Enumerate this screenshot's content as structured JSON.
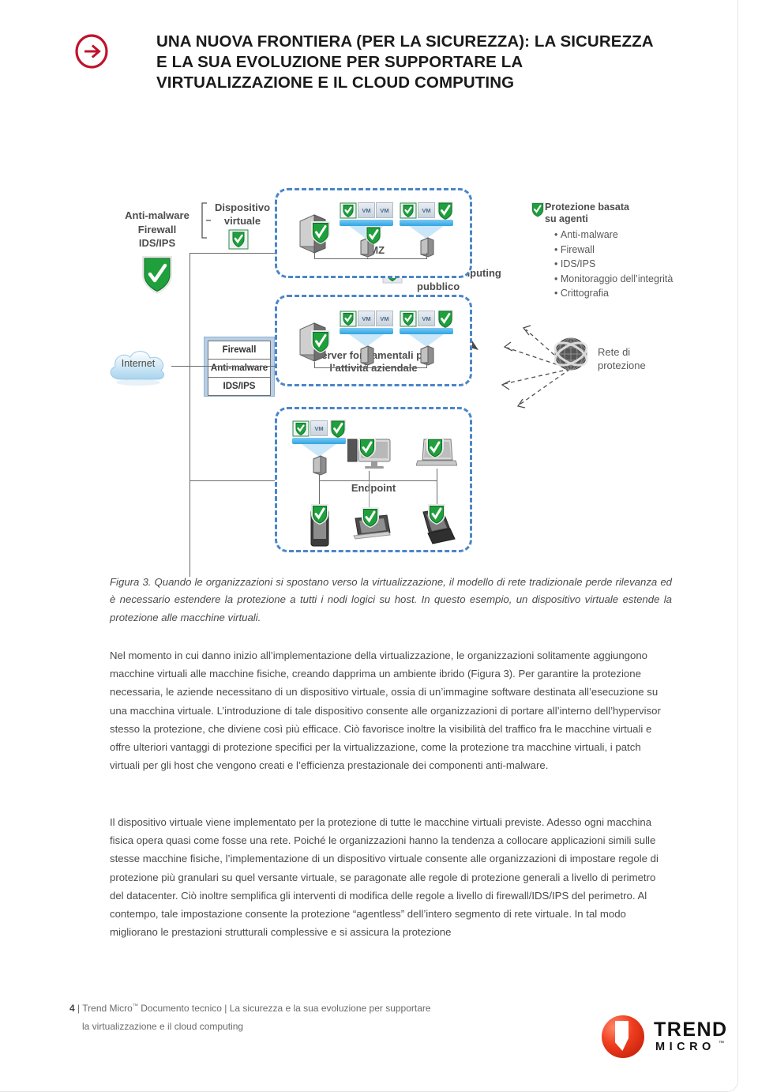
{
  "header": {
    "arrow_icon": "circle-arrow-right-icon",
    "title": "UNA NUOVA FRONTIERA (PER LA SICUREZZA): LA SICUREZZA E LA SUA EVOLUZIONE PER SUPPORTARE LA VIRTUALIZZAZIONE E IL CLOUD COMPUTING"
  },
  "figure": {
    "cloud_public_label": "Cloud computing\npubblico",
    "left_label": "Anti-malware\nFirewall\nIDS/IPS",
    "virtual_appliance_label": "Dispositivo\nvirtuale",
    "internet_label": "Internet",
    "firewall_box": [
      "Firewall",
      "Anti-malware",
      "IDS/IPS"
    ],
    "zones": [
      {
        "caption": "DMZ"
      },
      {
        "caption": "Server fondamentali per\nl’attività aziendale"
      },
      {
        "caption": "Endpoint"
      }
    ],
    "vm_chip_label": "VM",
    "agent_protection": {
      "title": "Protezione basata\nsu agenti",
      "items": [
        "Anti-malware",
        "Firewall",
        "IDS/IPS",
        "Monitoraggio dell’integrità",
        "Crittografia"
      ]
    },
    "protection_network_label": "Rete di\nprotezione",
    "colors": {
      "zone_border": "#4a86c8",
      "shield_green": "#1fa03c",
      "vm_bar": "#2fa6e4",
      "firewall_box_fill": "#b9cfe6"
    }
  },
  "caption": "Figura 3. Quando le organizzazioni si spostano verso la virtualizzazione, il modello di rete tradizionale perde rilevanza ed è necessario estendere la protezione a tutti i nodi logici su host. In questo esempio, un dispositivo virtuale estende la protezione alle macchine virtuali.",
  "body": {
    "p1": "Nel momento in cui danno inizio all’implementazione della virtualizzazione, le organizzazioni solitamente aggiungono macchine virtuali alle macchine fisiche, creando dapprima un ambiente ibrido (Figura 3). Per garantire la protezione necessaria, le aziende necessitano di un dispositivo virtuale, ossia di un’immagine software destinata all’esecuzione su una macchina virtuale. L’introduzione di tale dispositivo consente alle organizzazioni di portare all’interno dell’hypervisor stesso la protezione, che diviene così più efficace. Ciò favorisce inoltre la visibilità del traffico fra le macchine virtuali e offre ulteriori vantaggi di protezione specifici per la virtualizzazione, come la protezione tra macchine virtuali, i patch virtuali per gli host che vengono creati e l’efficienza prestazionale dei componenti anti-malware.",
    "p2": "Il dispositivo virtuale viene implementato per la protezione di tutte le macchine virtuali previste. Adesso ogni macchina fisica opera quasi come fosse una rete. Poiché le organizzazioni hanno la tendenza a collocare applicazioni simili sulle stesse macchine fisiche, l’implementazione di un dispositivo virtuale consente alle organizzazioni di impostare regole di protezione più granulari su quel versante virtuale, se paragonate alle regole di protezione generali a livello di perimetro del datacenter. Ciò inoltre semplifica gli interventi di modifica delle regole a livello di firewall/IDS/IPS del perimetro. Al contempo, tale impostazione consente la protezione “agentless” dell’intero segmento di rete virtuale. In tal modo migliorano le prestazioni strutturali complessive e si assicura la protezione"
  },
  "footer": {
    "page_number": "4",
    "sep": "|",
    "brand": "Trend Micro",
    "tm": "™",
    "doc_type": "Documento tecnico",
    "sep2": "|",
    "doc_title": "La sicurezza e la sua evoluzione per supportare",
    "doc_title_2": "la virtualizzazione e il cloud computing",
    "logo_trend": "TREND",
    "logo_micro": "MICRO",
    "logo_tm": "™"
  }
}
